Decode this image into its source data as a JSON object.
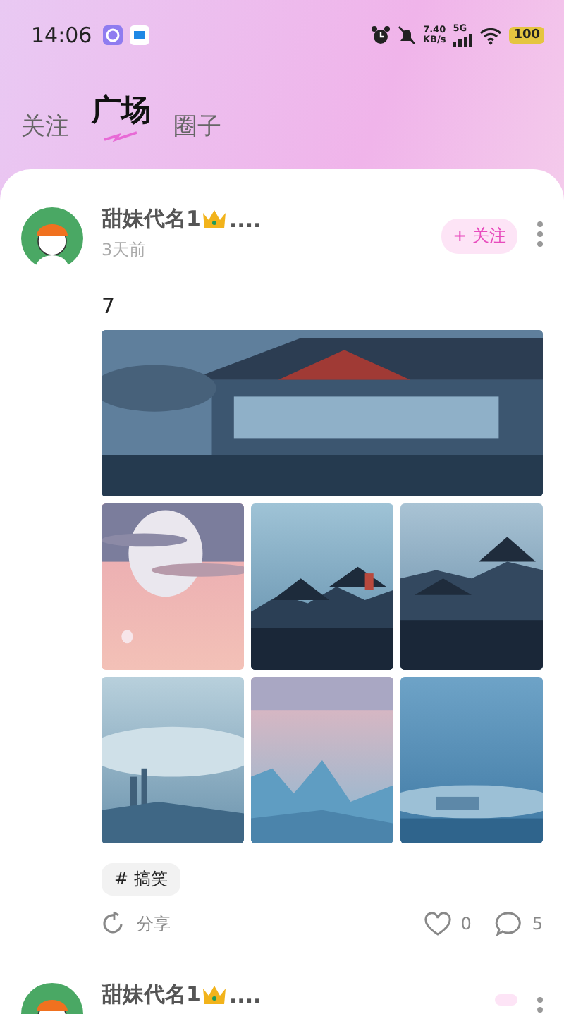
{
  "status_bar": {
    "time": "14:06",
    "net_speed_value": "7.40",
    "net_speed_unit": "KB/s",
    "network": "5G",
    "battery": "100"
  },
  "tabs": [
    {
      "label": "关注",
      "selected": false
    },
    {
      "label": "广场",
      "selected": true
    },
    {
      "label": "圈子",
      "selected": false
    }
  ],
  "posts": [
    {
      "author": "甜妹代名1",
      "author_suffix": "....",
      "time": "3天前",
      "follow": "+ 关注",
      "text": "7",
      "tag": "# 搞笑",
      "share": "分享",
      "likes": "0",
      "comments": "5"
    },
    {
      "author": "甜妹代名1",
      "author_suffix": "...."
    }
  ]
}
